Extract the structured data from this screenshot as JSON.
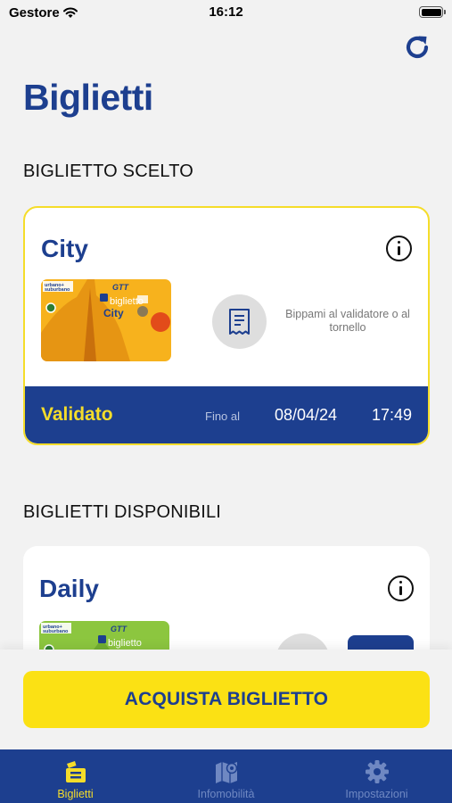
{
  "status_bar": {
    "carrier": "Gestore",
    "time": "16:12"
  },
  "header": {
    "title": "Biglietti",
    "refresh_icon": "refresh-icon"
  },
  "selected_section": {
    "label": "BIGLIETTO SCELTO",
    "card": {
      "name": "City",
      "instruction": "Bippami al validatore o al tornello",
      "status": "Validato",
      "until_label": "Fino al",
      "date": "08/04/24",
      "time": "17:49"
    }
  },
  "available_section": {
    "label": "BIGLIETTI DISPONIBILI",
    "cards": [
      {
        "name": "Daily"
      }
    ]
  },
  "ticket_art": {
    "line1": "urbano+",
    "line2": "suburbano",
    "brand": "GTT",
    "word": "biglietto",
    "city": "City"
  },
  "buy_button": {
    "label": "ACQUISTA BIGLIETTO"
  },
  "tabbar": {
    "items": [
      {
        "label": "Biglietti",
        "icon": "ticket-icon",
        "active": true
      },
      {
        "label": "Infomobilità",
        "icon": "map-pin-icon",
        "active": false
      },
      {
        "label": "Impostazioni",
        "icon": "gear-icon",
        "active": false
      }
    ]
  },
  "colors": {
    "brand_blue": "#1d3f8f",
    "brand_yellow": "#f5dd2a",
    "background": "#f2f2f2"
  }
}
